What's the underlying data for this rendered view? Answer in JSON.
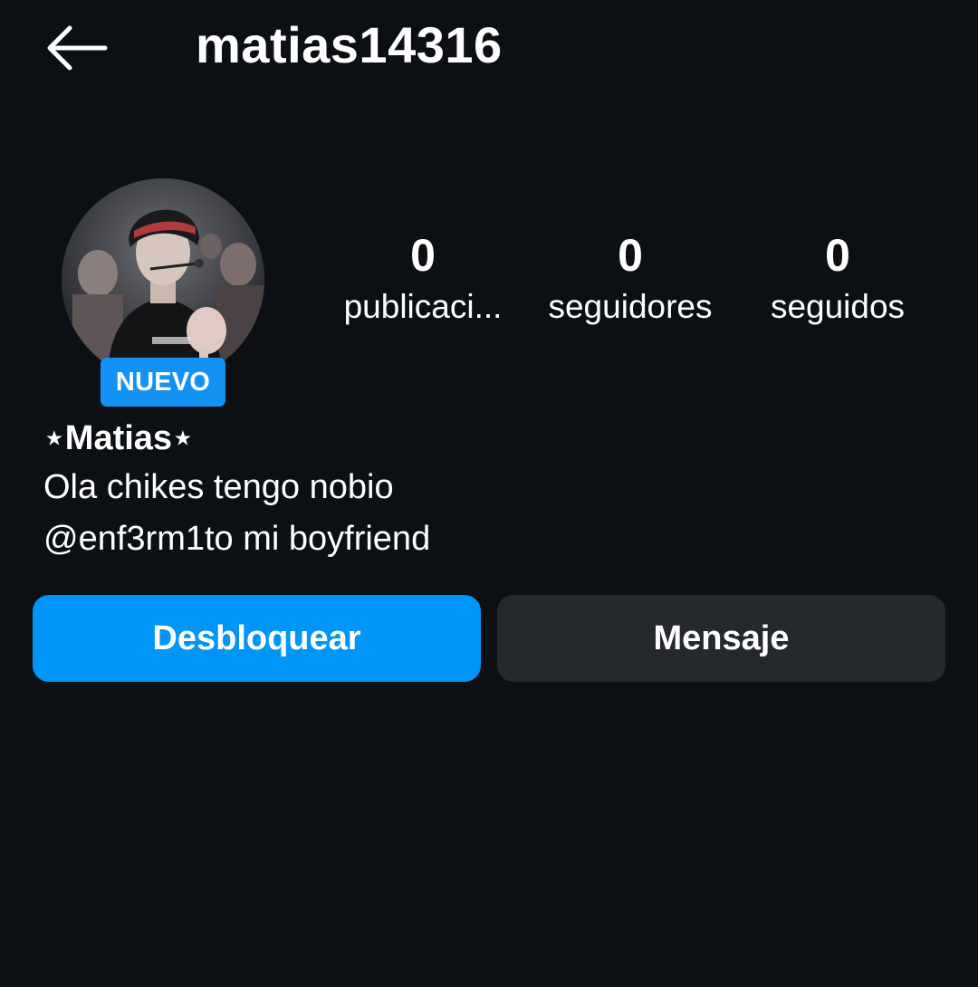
{
  "header": {
    "back_icon": "arrow-left-icon",
    "username": "matias14316"
  },
  "profile": {
    "avatar_icon": "profile-photo",
    "badge": "NUEVO",
    "badge_color": "#1492f3",
    "stats": [
      {
        "value": "0",
        "label": "publicaci..."
      },
      {
        "value": "0",
        "label": "seguidores"
      },
      {
        "value": "0",
        "label": "seguidos"
      }
    ],
    "display_name": "⋆Matias⋆",
    "bio": [
      "Ola chikes tengo nobio",
      "@enf3rm1to mi boyfriend"
    ]
  },
  "actions": {
    "primary_label": "Desbloquear",
    "primary_color": "#0095f6",
    "secondary_label": "Mensaje",
    "secondary_color": "#25282d"
  },
  "colors": {
    "background": "#0c1014",
    "text": "#ffffff"
  }
}
